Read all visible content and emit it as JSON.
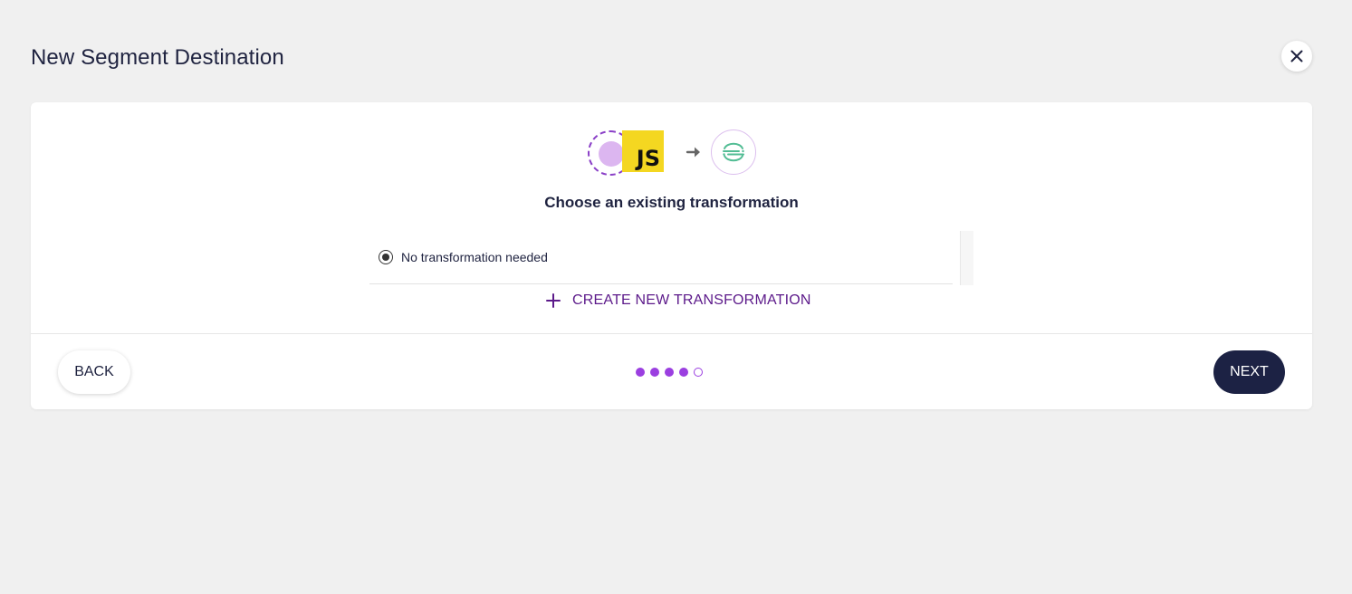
{
  "header": {
    "title": "New Segment Destination",
    "close_icon": "close-icon"
  },
  "flow": {
    "source_icon": "source-placeholder-icon",
    "transform_icon": "javascript-logo",
    "transform_text": "JS",
    "arrow_icon": "arrow-right-icon",
    "destination_icon": "segment-logo"
  },
  "main": {
    "heading": "Choose an existing transformation",
    "options": [
      {
        "label": "No transformation needed",
        "selected": true
      }
    ],
    "create_label": "CREATE NEW TRANSFORMATION"
  },
  "footer": {
    "back_label": "BACK",
    "next_label": "NEXT",
    "steps_completed": 4,
    "steps_total": 5
  },
  "colors": {
    "background": "#f0f0f0",
    "accent_purple": "#9b3fe0",
    "link_purple": "#5c1a8a",
    "primary_button": "#1c2244",
    "js_yellow": "#f4d721",
    "segment_green": "#52bd94"
  }
}
